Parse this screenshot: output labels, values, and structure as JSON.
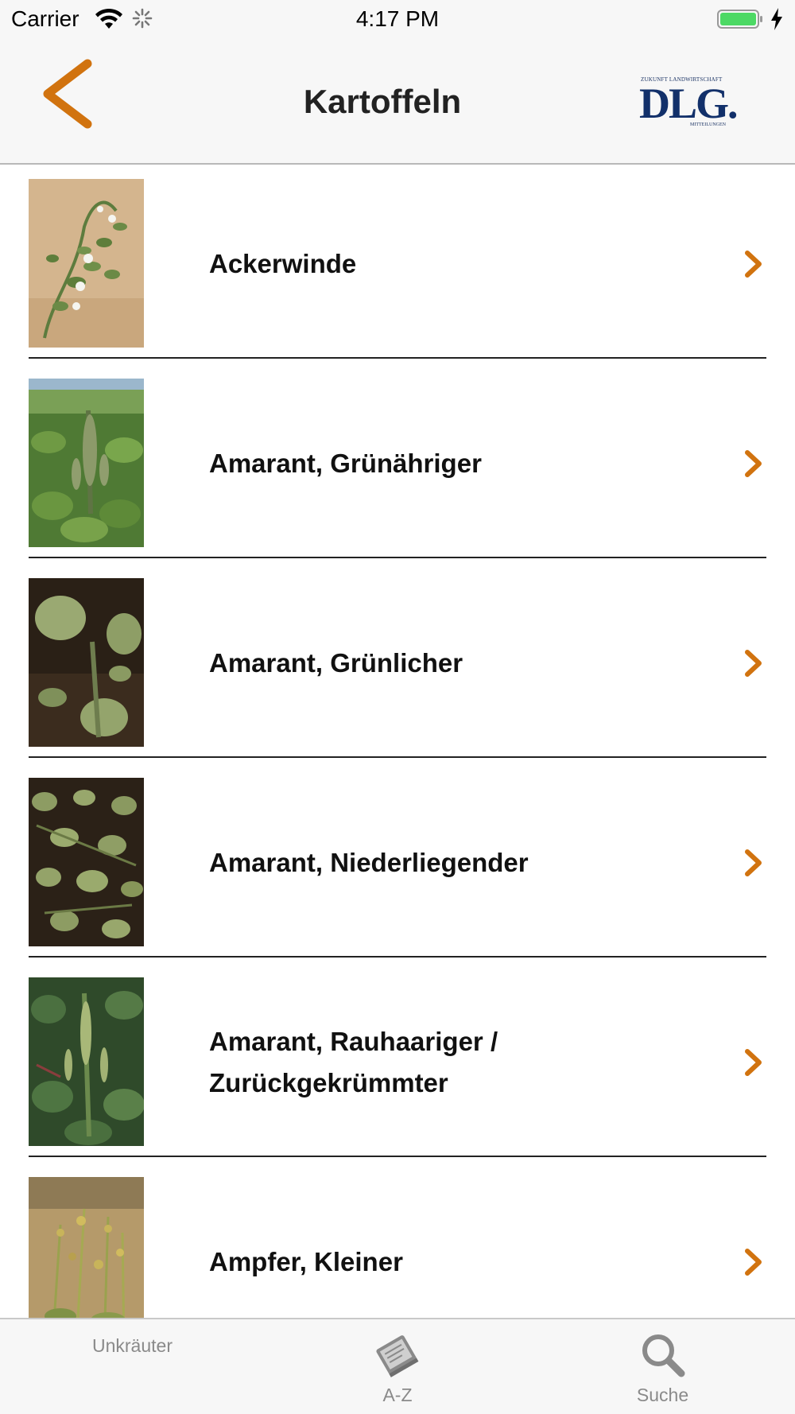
{
  "status_bar": {
    "carrier": "Carrier",
    "time": "4:17 PM"
  },
  "nav": {
    "title": "Kartoffeln",
    "back_icon": "chevron-left-icon",
    "logo": {
      "top_text": "ZUKUNFT LANDWIRTSCHAFT",
      "main_text": "DLG.",
      "bottom_text": "MITTEILUNGEN"
    }
  },
  "colors": {
    "accent": "#d1730f",
    "logo_blue": "#12306a",
    "bar_background": "#f7f7f7",
    "divider": "#222222",
    "tab_label": "#8a8a8a"
  },
  "list": {
    "items": [
      {
        "label": "Ackerwinde"
      },
      {
        "label": "Amarant, Grünähriger"
      },
      {
        "label": "Amarant, Grünlicher"
      },
      {
        "label": "Amarant, Niederliegender"
      },
      {
        "label": "Amarant, Rauhaariger / Zurückgekrümmter"
      },
      {
        "label": "Ampfer, Kleiner"
      }
    ]
  },
  "tab_bar": {
    "tabs": [
      {
        "label": "Unkräuter",
        "icon": ""
      },
      {
        "label": "A-Z",
        "icon": "book-icon"
      },
      {
        "label": "Suche",
        "icon": "magnifier-icon"
      }
    ]
  }
}
